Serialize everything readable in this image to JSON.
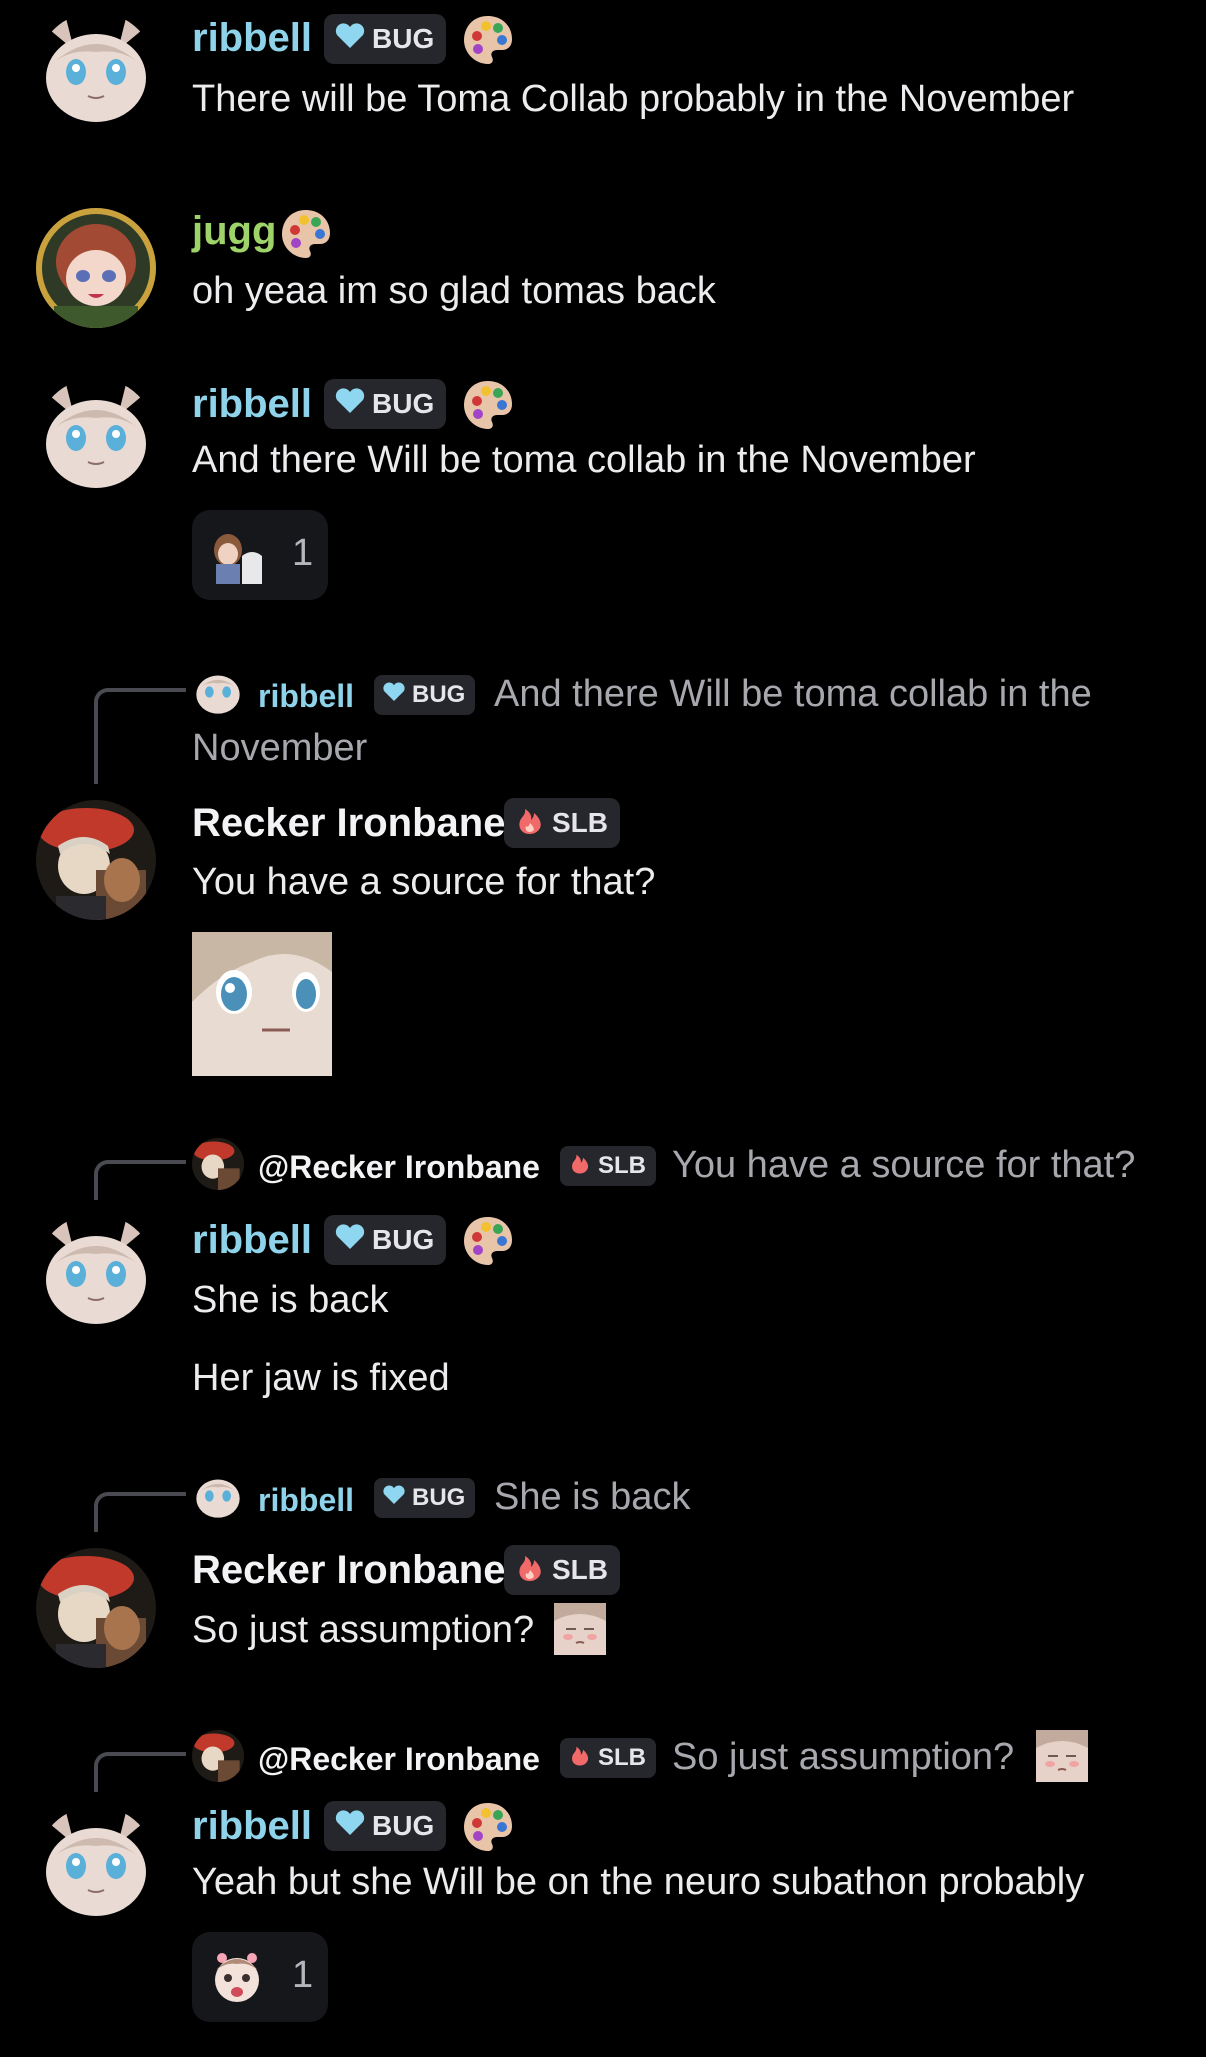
{
  "colors": {
    "background": "#000000",
    "ribbell": "#8fd3ea",
    "jugg": "#9ed36a",
    "recker": "#f3f3f5",
    "reply_text": "#a7a8ae"
  },
  "messages": [
    {
      "user": "ribbell",
      "tag": "BUG",
      "tag_icon": "heart-icon",
      "text": "There will be Toma Collab probably in the November"
    },
    {
      "user": "jugg",
      "text": "oh yeaa im so glad tomas back"
    },
    {
      "user": "ribbell",
      "tag": "BUG",
      "text": "And there Will be toma collab in the November",
      "reaction_count": "1"
    },
    {
      "reply": {
        "user": "ribbell",
        "tag": "BUG",
        "text_line1": "And there Will be toma collab in the",
        "text_line2": "November"
      },
      "user": "Recker Ironbane",
      "tag": "SLB",
      "tag_icon": "fire-icon",
      "text": "You have a source for that?"
    },
    {
      "reply": {
        "user": "@Recker Ironbane",
        "tag": "SLB",
        "text": "You have a source for that?"
      },
      "user": "ribbell",
      "tag": "BUG",
      "text": "She is back",
      "text2": "Her jaw is fixed"
    },
    {
      "reply": {
        "user": "ribbell",
        "tag": "BUG",
        "text": "She is back"
      },
      "user": "Recker Ironbane",
      "tag": "SLB",
      "text": "So just assumption?"
    },
    {
      "reply": {
        "user": "@Recker Ironbane",
        "tag": "SLB",
        "text": "So just assumption?"
      },
      "user": "ribbell",
      "tag": "BUG",
      "text": "Yeah but she Will be on the neuro subathon probably",
      "reaction_count": "1"
    }
  ]
}
